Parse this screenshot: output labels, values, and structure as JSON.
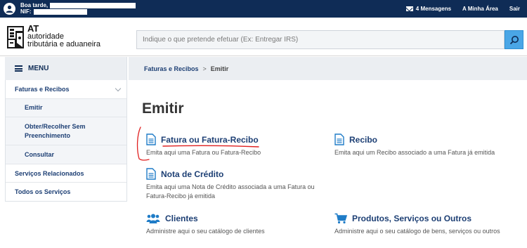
{
  "topbar": {
    "greeting": "Boa tarde,",
    "nif_label": "NIF:",
    "messages": "4 Mensagens",
    "my_area": "A Minha Área",
    "logout": "Sair"
  },
  "logo": {
    "abbr": "AT",
    "line1": "autoridade",
    "line2": "tributária e aduaneira"
  },
  "search": {
    "placeholder": "Indique o que pretende efetuar (Ex: Entregar IRS)"
  },
  "menu": {
    "label": "MENU",
    "items": [
      {
        "label": "Faturas e Recibos"
      },
      {
        "label": "Emitir"
      },
      {
        "label": "Obter/Recolher Sem Preenchimento"
      },
      {
        "label": "Consultar"
      },
      {
        "label": "Serviços Relacionados"
      },
      {
        "label": "Todos os Serviços"
      }
    ]
  },
  "breadcrumb": {
    "parent": "Faturas e Recibos",
    "separator": ">",
    "current": "Emitir"
  },
  "main": {
    "title": "Emitir",
    "cards": [
      {
        "name": "Fatura ou Fatura-Recibo",
        "desc": "Emita aqui uma Fatura ou Fatura-Recibo",
        "icon": "document-icon"
      },
      {
        "name": "Recibo",
        "desc": "Emita aqui um Recibo associado a uma Fatura já emitida",
        "icon": "document-icon"
      },
      {
        "name": "Nota de Crédito",
        "desc": "Emita aqui uma Nota de Crédito associada a uma Fatura ou Fatura-Recibo já emitida",
        "icon": "document-icon"
      },
      {
        "name": "Clientes",
        "desc": "Administre aqui o seu catálogo de clientes",
        "icon": "users-icon"
      },
      {
        "name": "Produtos, Serviços ou Outros",
        "desc": "Administre aqui o seu catálogo de bens, serviços ou outros",
        "icon": "cart-icon"
      }
    ]
  },
  "colors": {
    "navy": "#0f2c56",
    "link": "#1d3f74",
    "accent": "#1f7cc7",
    "search_button": "#4aa6e6",
    "annotation": "#e02020"
  }
}
